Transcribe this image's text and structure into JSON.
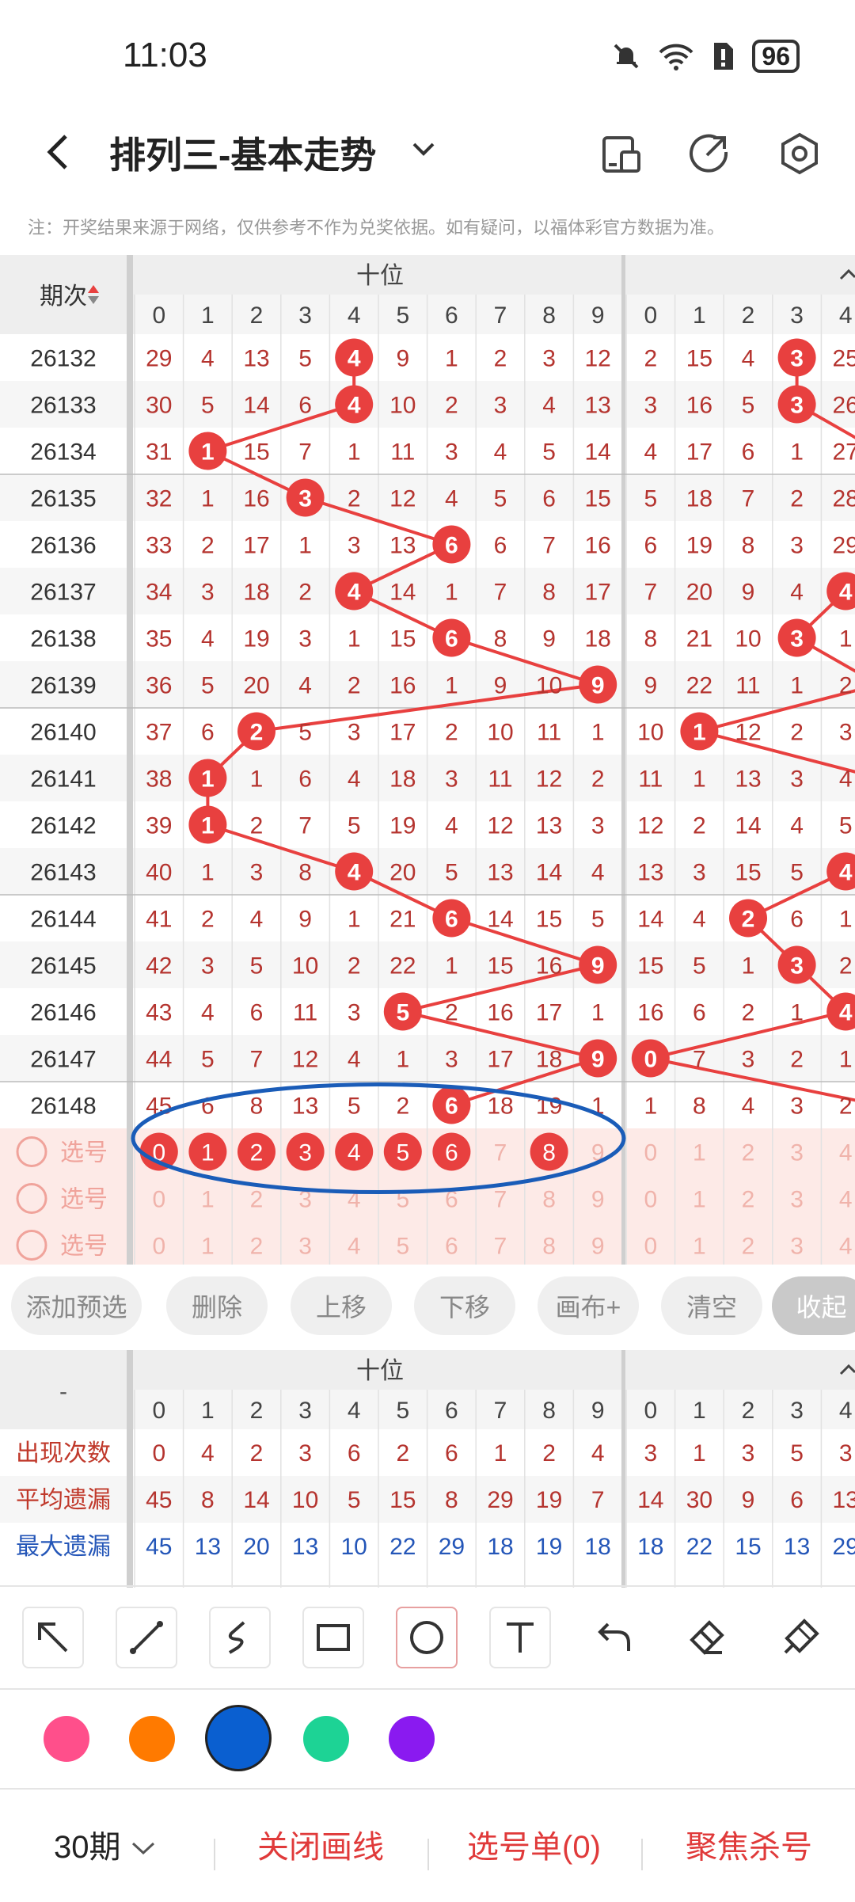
{
  "status": {
    "time": "11:03",
    "battery": "96"
  },
  "header": {
    "title": "排列三-基本走势",
    "back_icon": "back-arrow-icon",
    "icons": [
      "phone-layout-icon",
      "share-icon",
      "settings-icon"
    ]
  },
  "notice": "注：开奖结果来源于网络，仅供参考不作为兑奖依据。如有疑问，以福体彩官方数据为准。",
  "chart": {
    "period_header": "期次",
    "group1_title": "十位",
    "digits": [
      "0",
      "1",
      "2",
      "3",
      "4",
      "5",
      "6",
      "7",
      "8",
      "9"
    ],
    "group2_visible_digits": [
      "0",
      "1",
      "2",
      "3",
      "4"
    ],
    "rows": [
      {
        "period": "26132",
        "g1": [
          29,
          4,
          13,
          5,
          4,
          9,
          1,
          2,
          3,
          12
        ],
        "hit1": 4,
        "g2": [
          2,
          15,
          4,
          3,
          25
        ],
        "hit2": 3
      },
      {
        "period": "26133",
        "g1": [
          30,
          5,
          14,
          6,
          4,
          10,
          2,
          3,
          4,
          13
        ],
        "hit1": 4,
        "g2": [
          3,
          16,
          5,
          3,
          26
        ],
        "hit2": 3
      },
      {
        "period": "26134",
        "g1": [
          31,
          1,
          15,
          7,
          1,
          11,
          3,
          4,
          5,
          14
        ],
        "hit1": 1,
        "g2": [
          4,
          17,
          6,
          1,
          27
        ],
        "hit2": -1
      },
      {
        "period": "26135",
        "g1": [
          32,
          1,
          16,
          3,
          2,
          12,
          4,
          5,
          6,
          15
        ],
        "hit1": 3,
        "g2": [
          5,
          18,
          7,
          2,
          28
        ],
        "hit2": -1
      },
      {
        "period": "26136",
        "g1": [
          33,
          2,
          17,
          1,
          3,
          13,
          6,
          6,
          7,
          16
        ],
        "hit1": 6,
        "g2": [
          6,
          19,
          8,
          3,
          29
        ],
        "hit2": -1
      },
      {
        "period": "26137",
        "g1": [
          34,
          3,
          18,
          2,
          4,
          14,
          1,
          7,
          8,
          17
        ],
        "hit1": 4,
        "g2": [
          7,
          20,
          9,
          4,
          4
        ],
        "hit2": 4
      },
      {
        "period": "26138",
        "g1": [
          35,
          4,
          19,
          3,
          1,
          15,
          6,
          8,
          9,
          18
        ],
        "hit1": 6,
        "g2": [
          8,
          21,
          10,
          3,
          1
        ],
        "hit2": 3
      },
      {
        "period": "26139",
        "g1": [
          36,
          5,
          20,
          4,
          2,
          16,
          1,
          9,
          10,
          9
        ],
        "hit1": 9,
        "g2": [
          9,
          22,
          11,
          1,
          2
        ],
        "hit2": -1
      },
      {
        "period": "26140",
        "g1": [
          37,
          6,
          2,
          5,
          3,
          17,
          2,
          10,
          11,
          1
        ],
        "hit1": 2,
        "g2": [
          10,
          1,
          12,
          2,
          3
        ],
        "hit2": 1
      },
      {
        "period": "26141",
        "g1": [
          38,
          1,
          1,
          6,
          4,
          18,
          3,
          11,
          12,
          2
        ],
        "hit1": 1,
        "g2": [
          11,
          1,
          13,
          3,
          4
        ],
        "hit2": -1
      },
      {
        "period": "26142",
        "g1": [
          39,
          1,
          2,
          7,
          5,
          19,
          4,
          12,
          13,
          3
        ],
        "hit1": 1,
        "g2": [
          12,
          2,
          14,
          4,
          5
        ],
        "hit2": -1
      },
      {
        "period": "26143",
        "g1": [
          40,
          1,
          3,
          8,
          4,
          20,
          5,
          13,
          14,
          4
        ],
        "hit1": 4,
        "g2": [
          13,
          3,
          15,
          5,
          4
        ],
        "hit2": 4
      },
      {
        "period": "26144",
        "g1": [
          41,
          2,
          4,
          9,
          1,
          21,
          6,
          14,
          15,
          5
        ],
        "hit1": 6,
        "g2": [
          14,
          4,
          2,
          6,
          1
        ],
        "hit2": 2
      },
      {
        "period": "26145",
        "g1": [
          42,
          3,
          5,
          10,
          2,
          22,
          1,
          15,
          16,
          9
        ],
        "hit1": 9,
        "g2": [
          15,
          5,
          1,
          3,
          2
        ],
        "hit2": 3
      },
      {
        "period": "26146",
        "g1": [
          43,
          4,
          6,
          11,
          3,
          5,
          2,
          16,
          17,
          1
        ],
        "hit1": 5,
        "g2": [
          16,
          6,
          2,
          1,
          4
        ],
        "hit2": 4
      },
      {
        "period": "26147",
        "g1": [
          44,
          5,
          7,
          12,
          4,
          1,
          3,
          17,
          18,
          9
        ],
        "hit1": 9,
        "g2": [
          0,
          7,
          3,
          2,
          1
        ],
        "hit2": 0
      },
      {
        "period": "26148",
        "g1": [
          45,
          6,
          8,
          13,
          5,
          2,
          6,
          18,
          19,
          1
        ],
        "hit1": 6,
        "g2": [
          1,
          8,
          4,
          3,
          2
        ],
        "hit2": -1
      }
    ],
    "select_label": "选号",
    "selected_digits_row1": [
      0,
      1,
      2,
      3,
      4,
      5,
      6,
      8
    ]
  },
  "pills": [
    "添加预选",
    "删除",
    "上移",
    "下移",
    "画布+",
    "清空",
    "收起"
  ],
  "stats": {
    "corner": "-",
    "group1_title": "十位",
    "rows": [
      {
        "label": "出现次数",
        "g1": [
          0,
          4,
          2,
          3,
          6,
          2,
          6,
          1,
          2,
          4
        ],
        "g2": [
          3,
          1,
          3,
          5,
          3
        ]
      },
      {
        "label": "平均遗漏",
        "g1": [
          45,
          8,
          14,
          10,
          5,
          15,
          8,
          29,
          19,
          7
        ],
        "g2": [
          14,
          30,
          9,
          6,
          13
        ]
      },
      {
        "label": "最大遗漏",
        "g1": [
          45,
          13,
          20,
          13,
          10,
          22,
          29,
          18,
          19,
          18
        ],
        "g2": [
          18,
          22,
          15,
          13,
          29
        ]
      }
    ]
  },
  "tools": [
    "select-arrow-icon",
    "line-icon",
    "freehand-icon",
    "rectangle-icon",
    "circle-icon",
    "text-icon",
    "undo-icon",
    "eraser-icon",
    "clear-brush-icon"
  ],
  "colors": [
    "#ff4f8b",
    "#ff7a00",
    "#0a5fd0",
    "#1dd395",
    "#8a1af0"
  ],
  "bottom": {
    "periods": "30期",
    "close_draw": "关闭画线",
    "selection": "选号单(0)",
    "focus_kill": "聚焦杀号"
  },
  "accent": "#e8403f",
  "annotation_color": "#1a5cb8"
}
